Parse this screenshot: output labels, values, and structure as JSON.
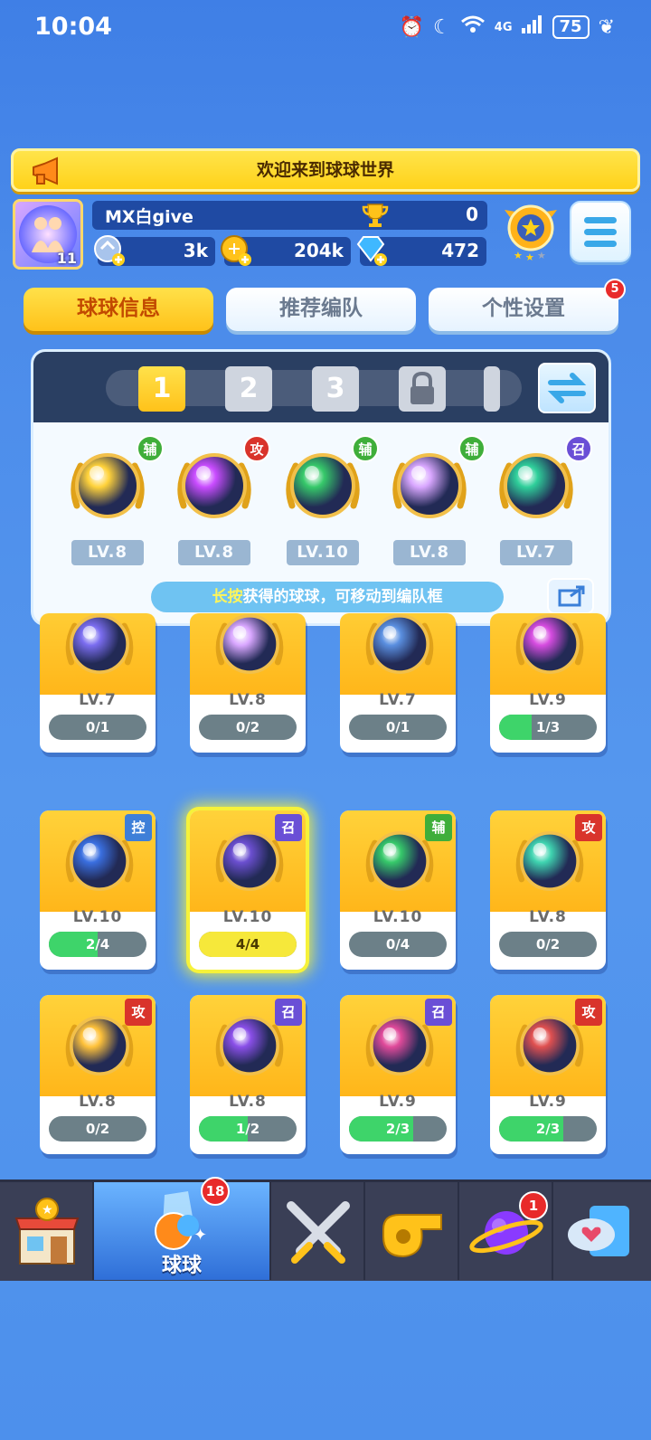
{
  "status_bar": {
    "time": "10:04",
    "battery": "75",
    "network": "4G"
  },
  "banner": {
    "text": "欢迎来到球球世界"
  },
  "player": {
    "name": "MX白give",
    "avatar_level": "11",
    "trophies": "0",
    "stamina": "3k",
    "coins": "204k",
    "diamonds": "472"
  },
  "tabs": [
    {
      "label": "球球信息",
      "active": true
    },
    {
      "label": "推荐编队",
      "active": false
    },
    {
      "label": "个性设置",
      "active": false,
      "badge": "5"
    }
  ],
  "team": {
    "slots": [
      "1",
      "2",
      "3"
    ],
    "hint_highlight": "长按",
    "hint_text": "获得的球球，可移动到编队框",
    "members": [
      {
        "icon": "sun-ball",
        "tag": "辅",
        "level": "LV.8",
        "color": "#ffd23a"
      },
      {
        "icon": "prism-ball",
        "tag": "攻",
        "level": "LV.8",
        "color": "#c94cff"
      },
      {
        "icon": "star-arrow-ball",
        "tag": "辅",
        "level": "LV.10",
        "color": "#36c96a"
      },
      {
        "icon": "people-ball",
        "tag": "辅",
        "level": "LV.8",
        "color": "#d9a7ff"
      },
      {
        "icon": "portal-ball",
        "tag": "召",
        "level": "LV.7",
        "color": "#2fcf9a"
      }
    ]
  },
  "collection": [
    {
      "icon": "grid-ball",
      "level": "LV.7",
      "progress": "0/1",
      "fill": 0,
      "color": "#7b6df0"
    },
    {
      "icon": "people-ball",
      "level": "LV.8",
      "progress": "0/2",
      "fill": 0,
      "color": "#d9a7ff"
    },
    {
      "icon": "swirl-ball",
      "level": "LV.7",
      "progress": "0/1",
      "fill": 0,
      "color": "#5a8fe0"
    },
    {
      "icon": "mushroom-ball",
      "level": "LV.9",
      "progress": "1/3",
      "fill": 0.33,
      "color": "#d64ce0"
    },
    {
      "icon": "clock-ball",
      "level": "LV.10",
      "progress": "2/4",
      "fill": 0.5,
      "tag": "控",
      "color": "#3a6fe0"
    },
    {
      "icon": "ghost-ball",
      "level": "LV.10",
      "progress": "4/4",
      "fill": 1,
      "tag": "召",
      "selected": true,
      "color": "#6b4fd0"
    },
    {
      "icon": "star-arrow-ball",
      "level": "LV.10",
      "progress": "0/4",
      "fill": 0,
      "tag": "辅",
      "color": "#36c96a"
    },
    {
      "icon": "tornado-ball",
      "level": "LV.8",
      "progress": "0/2",
      "fill": 0,
      "tag": "攻",
      "color": "#3fd4b0"
    },
    {
      "icon": "shuriken-ball",
      "level": "LV.8",
      "progress": "0/2",
      "fill": 0,
      "tag": "攻",
      "color": "#ffc23a"
    },
    {
      "icon": "planet-ball",
      "level": "LV.8",
      "progress": "1/2",
      "fill": 0.5,
      "tag": "召",
      "color": "#8a4fe8"
    },
    {
      "icon": "knife-ball",
      "level": "LV.9",
      "progress": "2/3",
      "fill": 0.66,
      "tag": "召",
      "color": "#e04a9a"
    },
    {
      "icon": "fist-ball",
      "level": "LV.9",
      "progress": "2/3",
      "fill": 0.66,
      "tag": "攻",
      "color": "#e05050"
    }
  ],
  "nav": {
    "items": [
      {
        "name": "shop-icon"
      },
      {
        "name": "balls-icon",
        "label": "球球",
        "badge": "18",
        "active": true
      },
      {
        "name": "battle-icon"
      },
      {
        "name": "whistle-icon"
      },
      {
        "name": "planet-icon",
        "badge": "1"
      },
      {
        "name": "social-icon"
      }
    ]
  }
}
